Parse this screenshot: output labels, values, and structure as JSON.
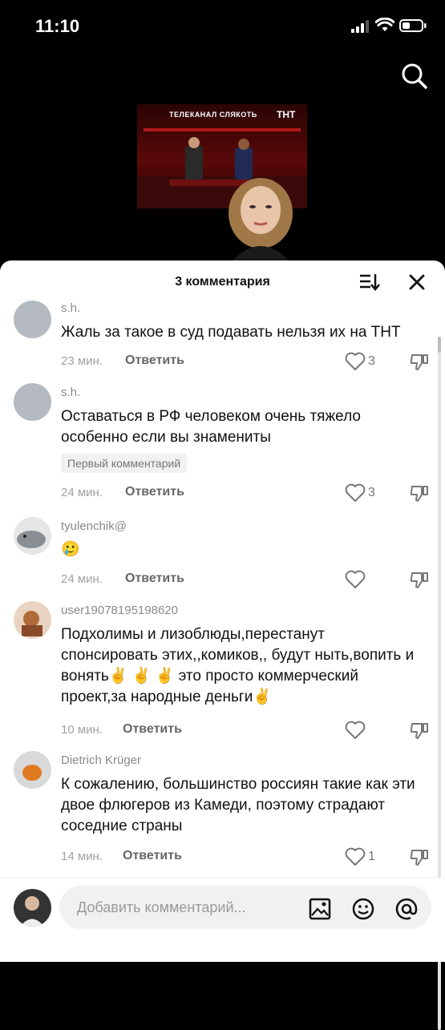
{
  "status_bar": {
    "time": "11:10"
  },
  "video": {
    "channel_label": "ТЕЛЕКАНАЛ СЛЯКОТЬ",
    "logo": "ТНТ"
  },
  "comments_sheet": {
    "title": "3 комментария",
    "comments": [
      {
        "user": "s.h.",
        "text": "Жаль за такое в суд подавать нельзя их на ТНТ",
        "time": "23 мин.",
        "reply": "Ответить",
        "likes": "3"
      },
      {
        "user": "s.h.",
        "text": "Оставаться в РФ человеком очень тяжело особенно если вы знамениты",
        "tag": "Первый комментарий",
        "time": "24 мин.",
        "reply": "Ответить",
        "likes": "3"
      },
      {
        "user": "tyulenchik@",
        "text": "🥲",
        "time": "24 мин.",
        "reply": "Ответить",
        "likes": ""
      },
      {
        "user": "user19078195198620",
        "text": "Подхолимы и лизоблюды,перестанут спонсировать этих,,комиков,, будут ныть,вопить и вонять✌️ ✌️ ✌️  это просто коммерческий проект,за народные деньги✌️",
        "time": "10 мин.",
        "reply": "Ответить",
        "likes": ""
      },
      {
        "user": "Dietrich Krüger",
        "text": "К сожалению, большинство россиян такие как эти двое флюгеров из Камеди, поэтому страдают соседние страны",
        "time": "14 мин.",
        "reply": "Ответить",
        "likes": "1"
      }
    ]
  },
  "footer": {
    "placeholder": "Добавить комментарий..."
  },
  "icons": [
    "signal-icon",
    "wifi-icon",
    "battery-icon",
    "search-icon",
    "sort-icon",
    "close-icon",
    "heart-icon",
    "dislike-icon",
    "image-icon",
    "emoji-icon",
    "mention-icon"
  ]
}
